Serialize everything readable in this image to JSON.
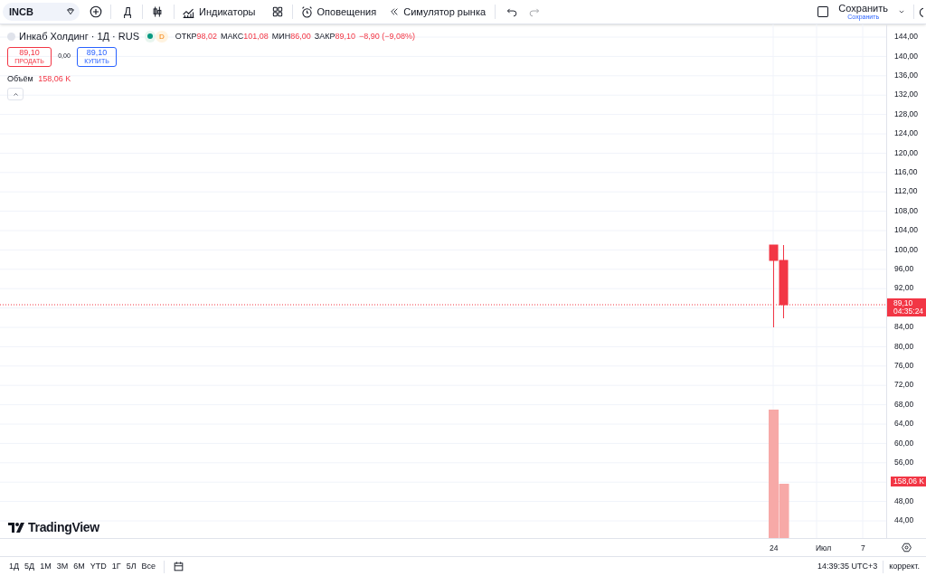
{
  "toolbar": {
    "symbol": "INCB",
    "interval": "Д",
    "indicators": "Индикаторы",
    "alerts": "Оповещения",
    "replay": "Симулятор рынка",
    "save": "Сохранить",
    "save_sub": "Сохранить"
  },
  "legend": {
    "title": "Инкаб Холдинг · 1Д · RUS",
    "badge": "D",
    "values": [
      {
        "label": "ОТКР",
        "value": "98,02"
      },
      {
        "label": "МАКС",
        "value": "101,08"
      },
      {
        "label": "МИН",
        "value": "86,00"
      },
      {
        "label": "ЗАКР",
        "value": "89,10"
      }
    ],
    "change": "−8,90 (−9,08%)"
  },
  "trade": {
    "sell": {
      "price": "89,10",
      "label": "ПРОДАТЬ"
    },
    "spread": "0,00",
    "buy": {
      "price": "89,10",
      "label": "КУПИТЬ"
    }
  },
  "volume": {
    "label": "Объём",
    "value": "158,06 K"
  },
  "logo": "TradingView",
  "price_axis": [
    {
      "kind": "label",
      "text": "144,00"
    },
    {
      "kind": "label",
      "text": "140,00"
    },
    {
      "kind": "label",
      "text": "136,00"
    },
    {
      "kind": "label",
      "text": "132,00"
    },
    {
      "kind": "label",
      "text": "128,00"
    },
    {
      "kind": "label",
      "text": "124,00"
    },
    {
      "kind": "label",
      "text": "120,00"
    },
    {
      "kind": "label",
      "text": "116,00"
    },
    {
      "kind": "label",
      "text": "112,00"
    },
    {
      "kind": "label",
      "text": "108,00"
    },
    {
      "kind": "label",
      "text": "104,00"
    },
    {
      "kind": "label",
      "text": "100,00"
    },
    {
      "kind": "label",
      "text": "96,00"
    },
    {
      "kind": "label",
      "text": "92,00"
    },
    {
      "kind": "last-price",
      "price": "89,10",
      "countdown": "04:35:24"
    },
    {
      "kind": "label",
      "text": "84,00"
    },
    {
      "kind": "label",
      "text": "80,00"
    },
    {
      "kind": "label",
      "text": "76,00"
    },
    {
      "kind": "label",
      "text": "72,00"
    },
    {
      "kind": "label",
      "text": "68,00"
    },
    {
      "kind": "label",
      "text": "64,00"
    },
    {
      "kind": "label",
      "text": "60,00"
    },
    {
      "kind": "label",
      "text": "56,00"
    },
    {
      "kind": "volume-tag",
      "text": "158,06 K"
    },
    {
      "kind": "label",
      "text": "48,00"
    },
    {
      "kind": "label",
      "text": "44,00"
    }
  ],
  "time_axis": [
    "24",
    "Июл",
    "7"
  ],
  "ranges": [
    "1Д",
    "5Д",
    "1М",
    "3М",
    "6М",
    "YTD",
    "1Г",
    "5Л",
    "Все"
  ],
  "status": {
    "time": "14:39:35 UTC+3",
    "adjust": "коррект."
  }
}
